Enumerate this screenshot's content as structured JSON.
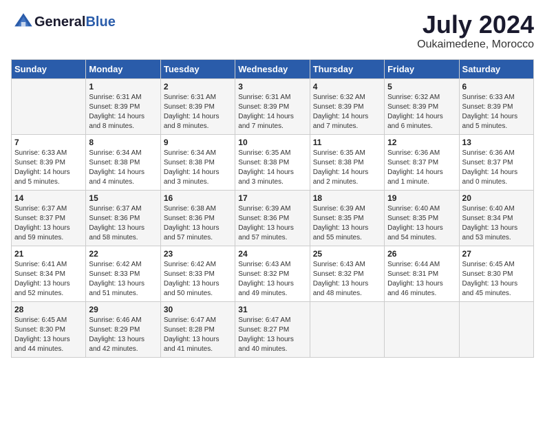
{
  "header": {
    "logo_general": "General",
    "logo_blue": "Blue",
    "month_year": "July 2024",
    "location": "Oukaimedene, Morocco"
  },
  "calendar": {
    "days_of_week": [
      "Sunday",
      "Monday",
      "Tuesday",
      "Wednesday",
      "Thursday",
      "Friday",
      "Saturday"
    ],
    "weeks": [
      [
        {
          "day": "",
          "sunrise": "",
          "sunset": "",
          "daylight": ""
        },
        {
          "day": "1",
          "sunrise": "Sunrise: 6:31 AM",
          "sunset": "Sunset: 8:39 PM",
          "daylight": "Daylight: 14 hours and 8 minutes."
        },
        {
          "day": "2",
          "sunrise": "Sunrise: 6:31 AM",
          "sunset": "Sunset: 8:39 PM",
          "daylight": "Daylight: 14 hours and 8 minutes."
        },
        {
          "day": "3",
          "sunrise": "Sunrise: 6:31 AM",
          "sunset": "Sunset: 8:39 PM",
          "daylight": "Daylight: 14 hours and 7 minutes."
        },
        {
          "day": "4",
          "sunrise": "Sunrise: 6:32 AM",
          "sunset": "Sunset: 8:39 PM",
          "daylight": "Daylight: 14 hours and 7 minutes."
        },
        {
          "day": "5",
          "sunrise": "Sunrise: 6:32 AM",
          "sunset": "Sunset: 8:39 PM",
          "daylight": "Daylight: 14 hours and 6 minutes."
        },
        {
          "day": "6",
          "sunrise": "Sunrise: 6:33 AM",
          "sunset": "Sunset: 8:39 PM",
          "daylight": "Daylight: 14 hours and 5 minutes."
        }
      ],
      [
        {
          "day": "7",
          "sunrise": "Sunrise: 6:33 AM",
          "sunset": "Sunset: 8:39 PM",
          "daylight": "Daylight: 14 hours and 5 minutes."
        },
        {
          "day": "8",
          "sunrise": "Sunrise: 6:34 AM",
          "sunset": "Sunset: 8:38 PM",
          "daylight": "Daylight: 14 hours and 4 minutes."
        },
        {
          "day": "9",
          "sunrise": "Sunrise: 6:34 AM",
          "sunset": "Sunset: 8:38 PM",
          "daylight": "Daylight: 14 hours and 3 minutes."
        },
        {
          "day": "10",
          "sunrise": "Sunrise: 6:35 AM",
          "sunset": "Sunset: 8:38 PM",
          "daylight": "Daylight: 14 hours and 3 minutes."
        },
        {
          "day": "11",
          "sunrise": "Sunrise: 6:35 AM",
          "sunset": "Sunset: 8:38 PM",
          "daylight": "Daylight: 14 hours and 2 minutes."
        },
        {
          "day": "12",
          "sunrise": "Sunrise: 6:36 AM",
          "sunset": "Sunset: 8:37 PM",
          "daylight": "Daylight: 14 hours and 1 minute."
        },
        {
          "day": "13",
          "sunrise": "Sunrise: 6:36 AM",
          "sunset": "Sunset: 8:37 PM",
          "daylight": "Daylight: 14 hours and 0 minutes."
        }
      ],
      [
        {
          "day": "14",
          "sunrise": "Sunrise: 6:37 AM",
          "sunset": "Sunset: 8:37 PM",
          "daylight": "Daylight: 13 hours and 59 minutes."
        },
        {
          "day": "15",
          "sunrise": "Sunrise: 6:37 AM",
          "sunset": "Sunset: 8:36 PM",
          "daylight": "Daylight: 13 hours and 58 minutes."
        },
        {
          "day": "16",
          "sunrise": "Sunrise: 6:38 AM",
          "sunset": "Sunset: 8:36 PM",
          "daylight": "Daylight: 13 hours and 57 minutes."
        },
        {
          "day": "17",
          "sunrise": "Sunrise: 6:39 AM",
          "sunset": "Sunset: 8:36 PM",
          "daylight": "Daylight: 13 hours and 57 minutes."
        },
        {
          "day": "18",
          "sunrise": "Sunrise: 6:39 AM",
          "sunset": "Sunset: 8:35 PM",
          "daylight": "Daylight: 13 hours and 55 minutes."
        },
        {
          "day": "19",
          "sunrise": "Sunrise: 6:40 AM",
          "sunset": "Sunset: 8:35 PM",
          "daylight": "Daylight: 13 hours and 54 minutes."
        },
        {
          "day": "20",
          "sunrise": "Sunrise: 6:40 AM",
          "sunset": "Sunset: 8:34 PM",
          "daylight": "Daylight: 13 hours and 53 minutes."
        }
      ],
      [
        {
          "day": "21",
          "sunrise": "Sunrise: 6:41 AM",
          "sunset": "Sunset: 8:34 PM",
          "daylight": "Daylight: 13 hours and 52 minutes."
        },
        {
          "day": "22",
          "sunrise": "Sunrise: 6:42 AM",
          "sunset": "Sunset: 8:33 PM",
          "daylight": "Daylight: 13 hours and 51 minutes."
        },
        {
          "day": "23",
          "sunrise": "Sunrise: 6:42 AM",
          "sunset": "Sunset: 8:33 PM",
          "daylight": "Daylight: 13 hours and 50 minutes."
        },
        {
          "day": "24",
          "sunrise": "Sunrise: 6:43 AM",
          "sunset": "Sunset: 8:32 PM",
          "daylight": "Daylight: 13 hours and 49 minutes."
        },
        {
          "day": "25",
          "sunrise": "Sunrise: 6:43 AM",
          "sunset": "Sunset: 8:32 PM",
          "daylight": "Daylight: 13 hours and 48 minutes."
        },
        {
          "day": "26",
          "sunrise": "Sunrise: 6:44 AM",
          "sunset": "Sunset: 8:31 PM",
          "daylight": "Daylight: 13 hours and 46 minutes."
        },
        {
          "day": "27",
          "sunrise": "Sunrise: 6:45 AM",
          "sunset": "Sunset: 8:30 PM",
          "daylight": "Daylight: 13 hours and 45 minutes."
        }
      ],
      [
        {
          "day": "28",
          "sunrise": "Sunrise: 6:45 AM",
          "sunset": "Sunset: 8:30 PM",
          "daylight": "Daylight: 13 hours and 44 minutes."
        },
        {
          "day": "29",
          "sunrise": "Sunrise: 6:46 AM",
          "sunset": "Sunset: 8:29 PM",
          "daylight": "Daylight: 13 hours and 42 minutes."
        },
        {
          "day": "30",
          "sunrise": "Sunrise: 6:47 AM",
          "sunset": "Sunset: 8:28 PM",
          "daylight": "Daylight: 13 hours and 41 minutes."
        },
        {
          "day": "31",
          "sunrise": "Sunrise: 6:47 AM",
          "sunset": "Sunset: 8:27 PM",
          "daylight": "Daylight: 13 hours and 40 minutes."
        },
        {
          "day": "",
          "sunrise": "",
          "sunset": "",
          "daylight": ""
        },
        {
          "day": "",
          "sunrise": "",
          "sunset": "",
          "daylight": ""
        },
        {
          "day": "",
          "sunrise": "",
          "sunset": "",
          "daylight": ""
        }
      ]
    ]
  }
}
